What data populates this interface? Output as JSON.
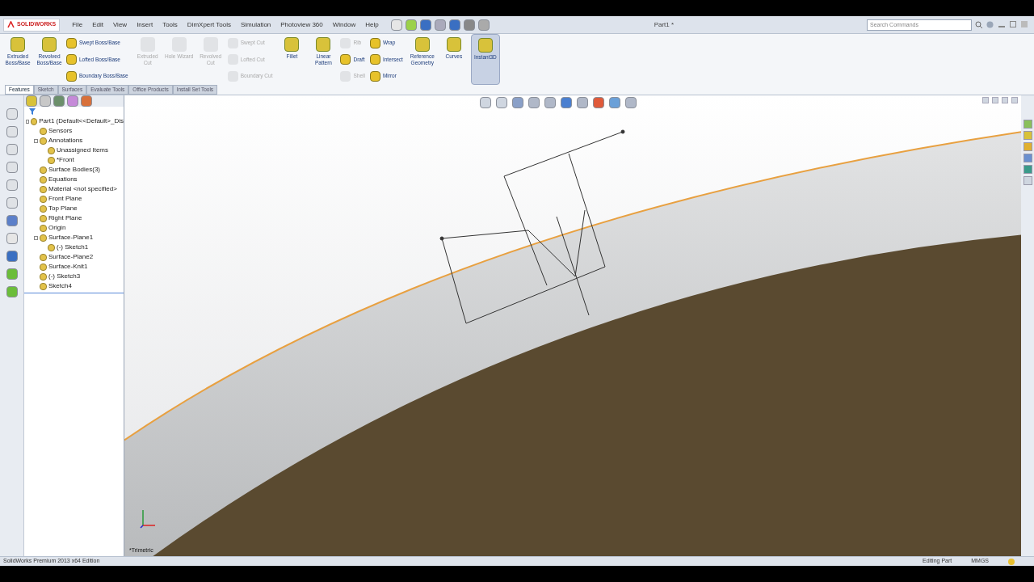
{
  "app": {
    "logo": "SOLIDWORKS",
    "title": "Part1 *",
    "search": {
      "placeholder": "Search Commands"
    }
  },
  "menu": [
    "File",
    "Edit",
    "View",
    "Insert",
    "Tools",
    "DimXpert Tools",
    "Simulation",
    "Photoview 360",
    "Window",
    "Help"
  ],
  "ribbon": {
    "columns": [
      {
        "kind": "large",
        "items": [
          {
            "label": "Extruded Boss/Base",
            "disabled": false,
            "selected": false
          }
        ]
      },
      {
        "kind": "large",
        "items": [
          {
            "label": "Revolved Boss/Base",
            "disabled": false,
            "selected": false
          }
        ]
      },
      {
        "kind": "small",
        "items": [
          {
            "label": "Swept Boss/Base",
            "disabled": false
          },
          {
            "label": "Lofted Boss/Base",
            "disabled": false
          },
          {
            "label": "Boundary Boss/Base",
            "disabled": false
          }
        ]
      },
      {
        "kind": "large",
        "items": [
          {
            "label": "Extruded Cut",
            "disabled": true,
            "selected": false
          }
        ]
      },
      {
        "kind": "large",
        "items": [
          {
            "label": "Hole Wizard",
            "disabled": true,
            "selected": false
          }
        ]
      },
      {
        "kind": "large",
        "items": [
          {
            "label": "Revolved Cut",
            "disabled": true,
            "selected": false
          }
        ]
      },
      {
        "kind": "small",
        "items": [
          {
            "label": "Swept Cut",
            "disabled": true
          },
          {
            "label": "Lofted Cut",
            "disabled": true
          },
          {
            "label": "Boundary Cut",
            "disabled": true
          }
        ]
      },
      {
        "kind": "large",
        "items": [
          {
            "label": "Fillet",
            "disabled": false,
            "selected": false
          }
        ]
      },
      {
        "kind": "large",
        "items": [
          {
            "label": "Linear Pattern",
            "disabled": false,
            "selected": false
          }
        ]
      },
      {
        "kind": "small",
        "items": [
          {
            "label": "Rib",
            "disabled": true
          },
          {
            "label": "Draft",
            "disabled": false
          },
          {
            "label": "Shell",
            "disabled": true
          }
        ]
      },
      {
        "kind": "small",
        "items": [
          {
            "label": "Wrap",
            "disabled": false
          },
          {
            "label": "Intersect",
            "disabled": false
          },
          {
            "label": "Mirror",
            "disabled": false
          }
        ]
      },
      {
        "kind": "large",
        "items": [
          {
            "label": "Reference Geometry",
            "disabled": false,
            "selected": false
          }
        ]
      },
      {
        "kind": "large",
        "items": [
          {
            "label": "Curves",
            "disabled": false,
            "selected": false
          }
        ]
      },
      {
        "kind": "large",
        "items": [
          {
            "label": "Instant3D",
            "disabled": false,
            "selected": true
          }
        ]
      }
    ]
  },
  "tabs": [
    {
      "label": "Features",
      "selected": true
    },
    {
      "label": "Sketch",
      "selected": false
    },
    {
      "label": "Surfaces",
      "selected": false
    },
    {
      "label": "Evaluate Tools",
      "selected": false
    },
    {
      "label": "Office Products",
      "selected": false
    },
    {
      "label": "Install Set Tools",
      "selected": false
    }
  ],
  "tree": [
    {
      "label": "Part1  (Default<<Default>_Dis",
      "children": [
        {
          "label": "Sensors"
        },
        {
          "label": "Annotations",
          "children": [
            {
              "label": "Unassigned Items"
            },
            {
              "label": "*Front"
            }
          ]
        },
        {
          "label": "Surface Bodies(3)"
        },
        {
          "label": "Equations"
        },
        {
          "label": "Material <not specified>"
        },
        {
          "label": "Front Plane"
        },
        {
          "label": "Top Plane"
        },
        {
          "label": "Right Plane"
        },
        {
          "label": "Origin"
        },
        {
          "label": "Surface-Plane1",
          "children": [
            {
              "label": "(-) Sketch1"
            }
          ]
        },
        {
          "label": "Surface-Plane2"
        },
        {
          "label": "Surface-Knit1"
        },
        {
          "label": "(-) Sketch3"
        },
        {
          "label": "Sketch4"
        }
      ]
    }
  ],
  "viewport": {
    "view_label": "*Trimetric"
  },
  "status_bar": {
    "product": "SolidWorks Premium 2013 x64 Edition",
    "mode": "Editing Part",
    "units": "MMGS"
  }
}
